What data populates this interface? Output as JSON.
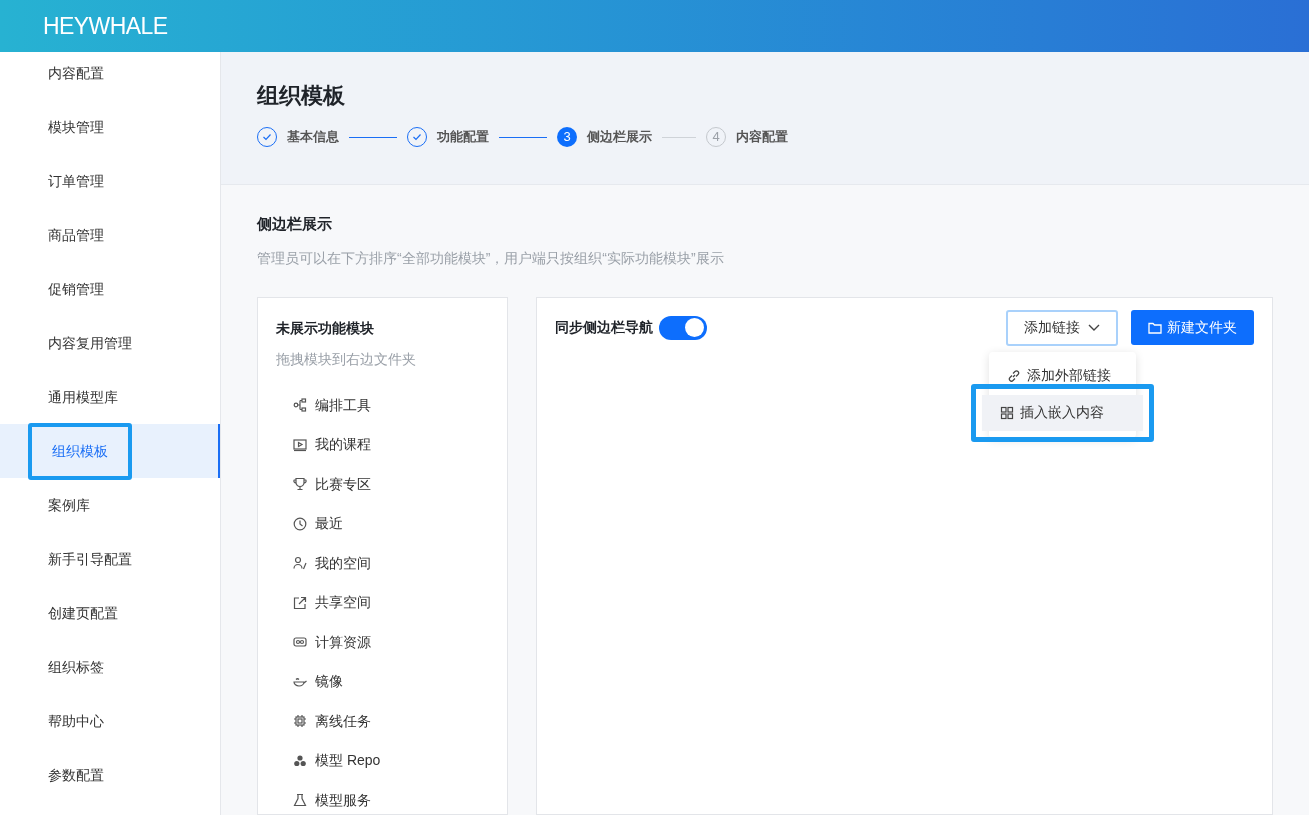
{
  "header": {
    "logo": "HEYWHALE"
  },
  "sidebar": {
    "items": [
      {
        "label": "内容配置",
        "selected": false,
        "highlighted": false
      },
      {
        "label": "模块管理",
        "selected": false,
        "highlighted": false
      },
      {
        "label": "订单管理",
        "selected": false,
        "highlighted": false
      },
      {
        "label": "商品管理",
        "selected": false,
        "highlighted": false
      },
      {
        "label": "促销管理",
        "selected": false,
        "highlighted": false
      },
      {
        "label": "内容复用管理",
        "selected": false,
        "highlighted": false
      },
      {
        "label": "通用模型库",
        "selected": false,
        "highlighted": false
      },
      {
        "label": "组织模板",
        "selected": true,
        "highlighted": true
      },
      {
        "label": "案例库",
        "selected": false,
        "highlighted": false
      },
      {
        "label": "新手引导配置",
        "selected": false,
        "highlighted": false
      },
      {
        "label": "创建页配置",
        "selected": false,
        "highlighted": false
      },
      {
        "label": "组织标签",
        "selected": false,
        "highlighted": false
      },
      {
        "label": "帮助中心",
        "selected": false,
        "highlighted": false
      },
      {
        "label": "参数配置",
        "selected": false,
        "highlighted": false
      }
    ]
  },
  "page": {
    "title": "组织模板",
    "steps": [
      {
        "label": "基本信息",
        "kind": "done"
      },
      {
        "label": "功能配置",
        "kind": "done"
      },
      {
        "number": "3",
        "label": "侧边栏展示",
        "kind": "active"
      },
      {
        "number": "4",
        "label": "内容配置",
        "kind": "wait"
      }
    ]
  },
  "section": {
    "title": "侧边栏展示",
    "description": "管理员可以在下方排序“全部功能模块”，用户端只按组织“实际功能模块”展示"
  },
  "hidden_modules": {
    "title": "未展示功能模块",
    "hint": "拖拽模块到右边文件夹",
    "items": [
      "编排工具",
      "我的课程",
      "比赛专区",
      "最近",
      "我的空间",
      "共享空间",
      "计算资源",
      "镜像",
      "离线任务",
      "模型 Repo",
      "模型服务"
    ]
  },
  "sidebar_preview": {
    "sync_label": "同步侧边栏导航",
    "sync_on": true,
    "add_link_button": "添加链接",
    "new_folder_button": "新建文件夹",
    "dropdown": [
      {
        "label": "添加外部链接",
        "hovered": false,
        "highlighted": false
      },
      {
        "label": "插入嵌入内容",
        "hovered": true,
        "highlighted": true
      }
    ]
  }
}
